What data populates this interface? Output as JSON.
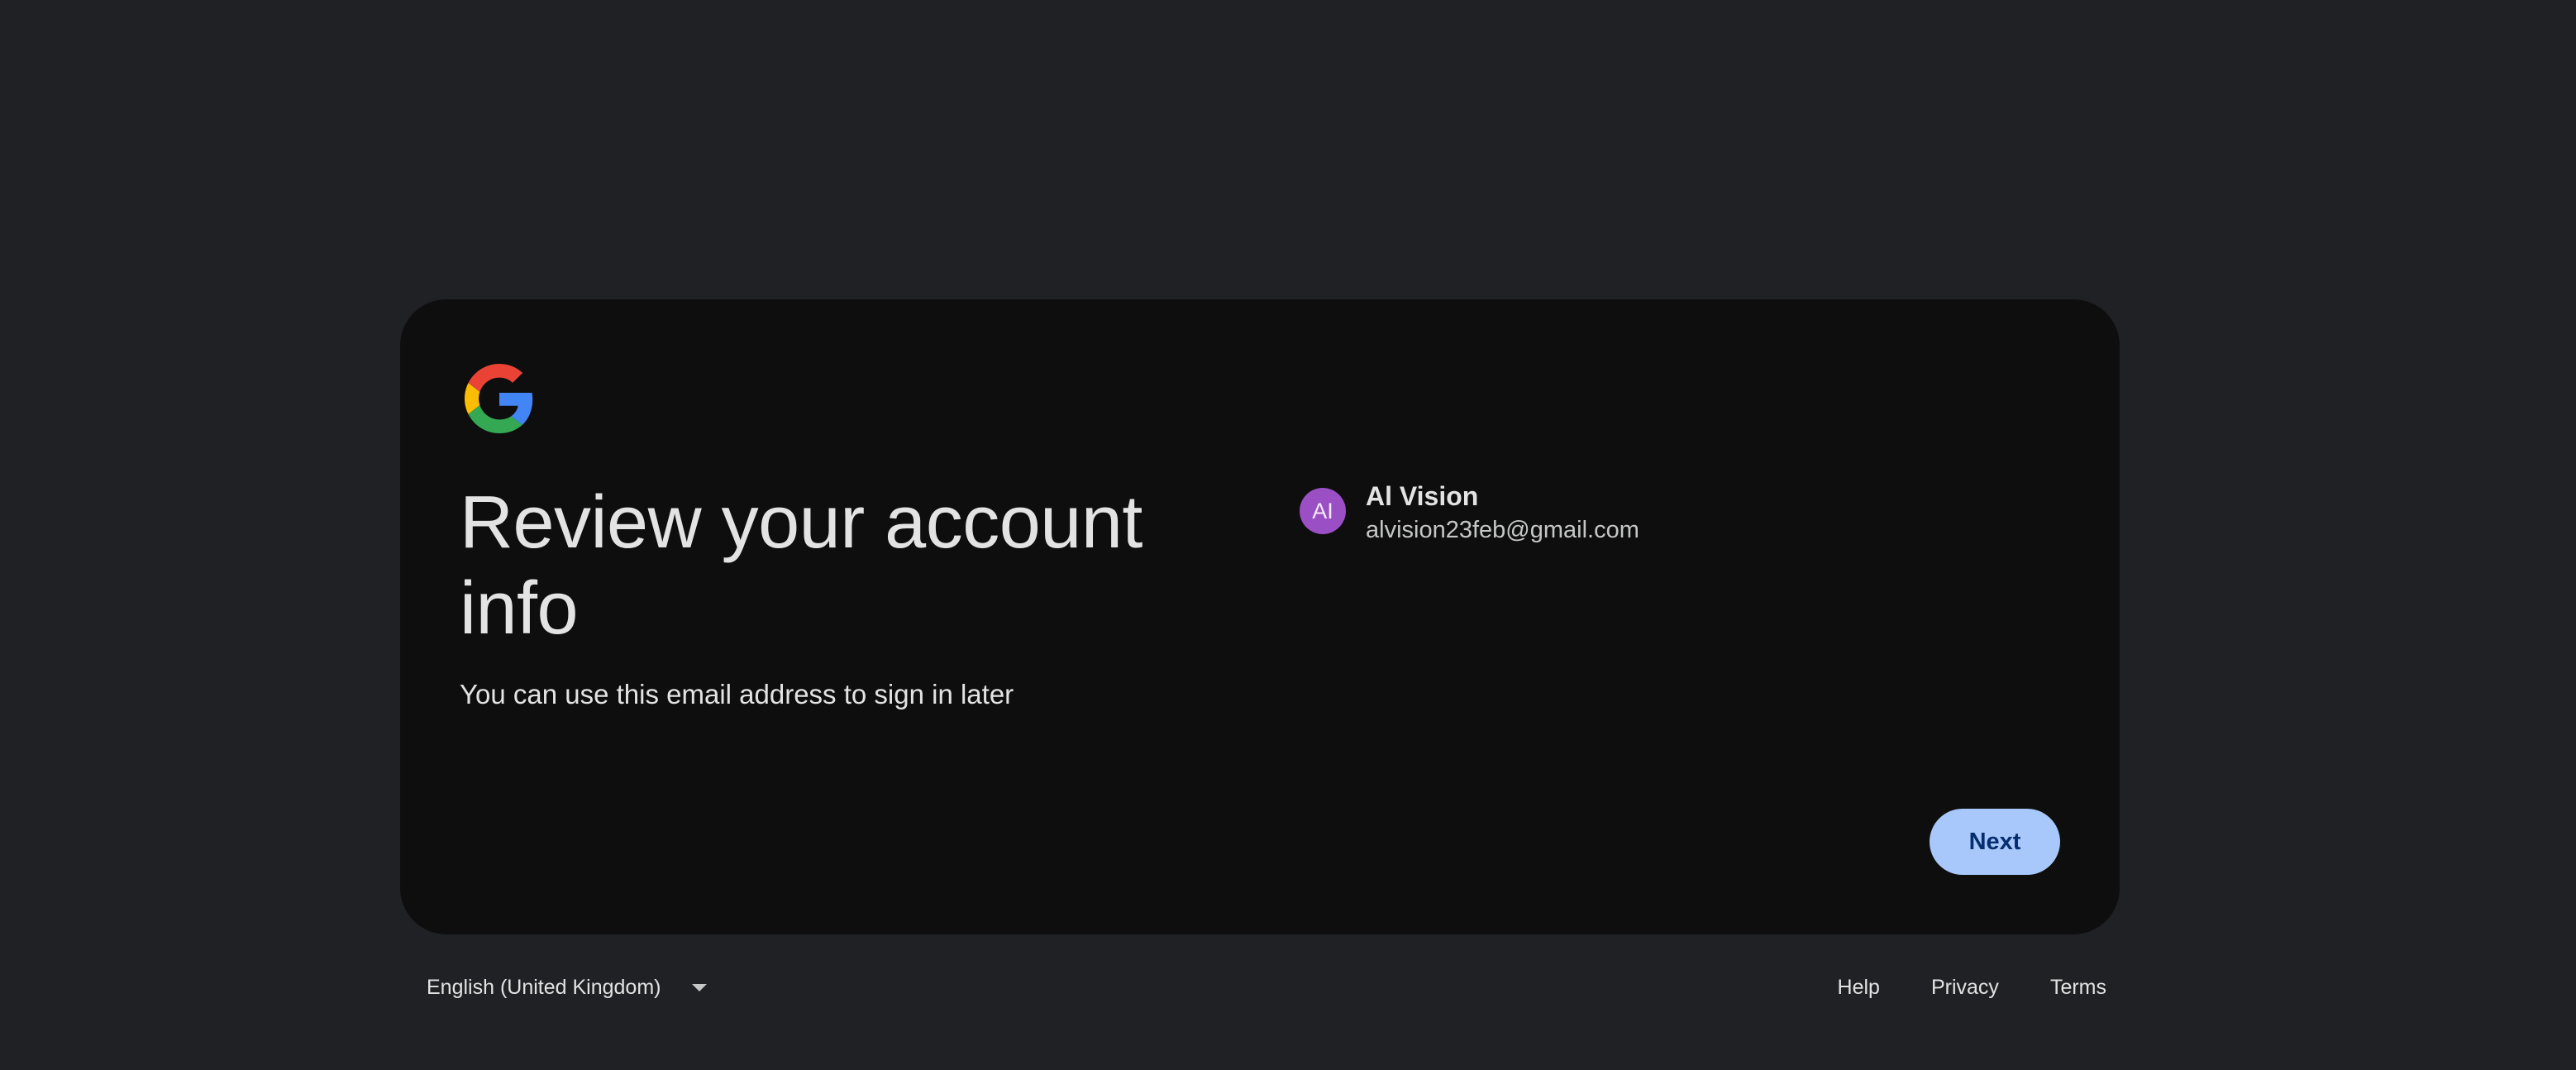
{
  "card": {
    "title": "Review your account info",
    "subtitle": "You can use this email address to sign in later",
    "account": {
      "initials": "AI",
      "name": "Al Vision",
      "email": "alvision23feb@gmail.com",
      "avatar_color": "#9b4fc4"
    },
    "next_label": "Next",
    "logo_icon": "google-g-icon"
  },
  "footer": {
    "language": "English (United Kingdom)",
    "links": [
      "Help",
      "Privacy",
      "Terms"
    ]
  },
  "colors": {
    "page_background": "#202124",
    "card_background": "#0e0e0e",
    "primary_button": "#a8c7fa",
    "primary_button_text": "#062e6f"
  }
}
